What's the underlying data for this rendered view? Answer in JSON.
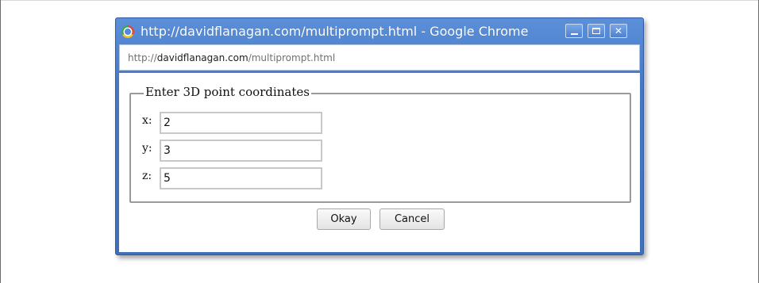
{
  "window": {
    "title": "http://davidflanagan.com/multiprompt.html - Google Chrome",
    "icon": "chrome-icon"
  },
  "addressbar": {
    "prefix": "http://",
    "host": "davidflanagan.com",
    "path": "/multiprompt.html"
  },
  "form": {
    "legend": "Enter 3D point coordinates",
    "fields": [
      {
        "label": "x:",
        "value": "2"
      },
      {
        "label": "y:",
        "value": "3"
      },
      {
        "label": "z:",
        "value": "5"
      }
    ],
    "ok_label": "Okay",
    "cancel_label": "Cancel"
  }
}
